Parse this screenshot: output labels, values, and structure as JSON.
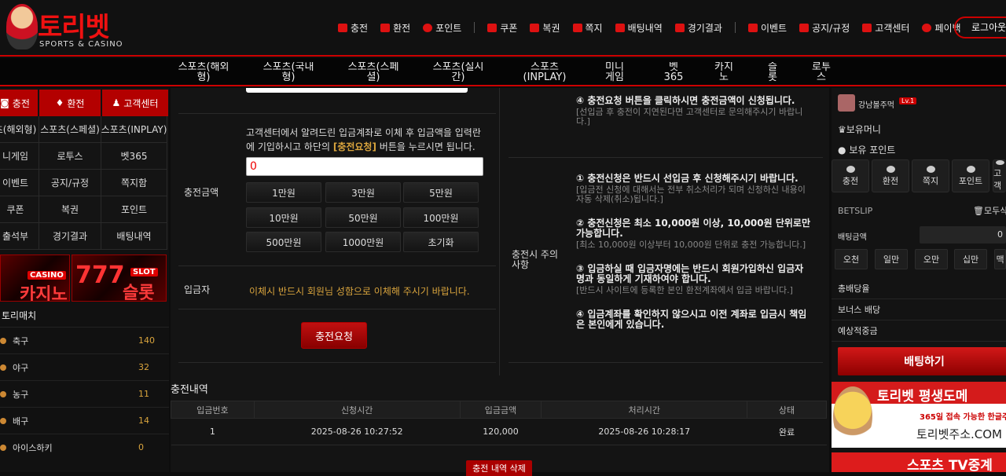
{
  "header": {
    "logo_text": "토리벳",
    "logo_sub": "SPORTS & CASINO",
    "logout": "로그아웃",
    "top_nav": [
      "충전",
      "환전",
      "포인트",
      "쿠폰",
      "복권",
      "쪽지",
      "배팅내역",
      "경기결과",
      "이벤트",
      "공지/규정",
      "고객센터",
      "페이백"
    ]
  },
  "main_nav": [
    "스포츠(해외형)",
    "스포츠(국내형)",
    "스포츠(스페셜)",
    "스포츠(실시간)",
    "스포츠(INPLAY)",
    "미니게임",
    "벳365",
    "카지노",
    "슬롯",
    "로투스"
  ],
  "left": {
    "buttons": [
      "충전",
      "환전",
      "고객센터"
    ],
    "grid": [
      "츠(해외형)",
      "스포츠(스페셜)",
      "스포츠(INPLAY)",
      "니게임",
      "로투스",
      "벳365",
      "이벤트",
      "공지/규정",
      "쪽지함",
      "쿠폰",
      "복권",
      "포인트",
      "출석부",
      "경기결과",
      "배팅내역"
    ],
    "banners": [
      {
        "tag": "CASINO",
        "title": "카지노"
      },
      {
        "tag": "SLOT",
        "title": "슬롯"
      }
    ],
    "sports_header": "토리매치",
    "sports": [
      {
        "name": "축구",
        "count": "140"
      },
      {
        "name": "야구",
        "count": "32"
      },
      {
        "name": "농구",
        "count": "11"
      },
      {
        "name": "배구",
        "count": "14"
      },
      {
        "name": "아이스하키",
        "count": "0"
      }
    ]
  },
  "charge": {
    "amount_label": "충전금액",
    "instruction": "고객센터에서 알려드린 입금계좌로 이체 후 입금액을 입력란에 기입하시고 하단의",
    "instruction_em": "[충전요청]",
    "instruction_end": "버튼을 누르시면 됩니다.",
    "amount_value": "0",
    "amount_buttons": [
      "1만원",
      "3만원",
      "5만원",
      "10만원",
      "50만원",
      "100만원",
      "500만원",
      "1000만원",
      "초기화"
    ],
    "depositor_label": "입금자",
    "depositor_text": "이체시 반드시 회원님 성함으로 이체해 주시기 바랍니다.",
    "submit": "충전요청",
    "notes_label": "충전시 주의사항",
    "notes": [
      {
        "h": "④ 충전요청 버튼을 클릭하시면 충전금액이 신청됩니다.",
        "p": "[선입금 후 충전이 지연된다면 고객센터로 문의해주시기 바랍니다.]"
      },
      {
        "h": "① 충전신청은 반드시 선입금 후 신청해주시기 바랍니다.",
        "p": "[입금전 신청에 대해서는 전부 취소처리가 되며 신청하신 내용이 자동 삭제(취소)됩니다.]"
      },
      {
        "h": "② 충전신청은 최소 10,000원 이상, 10,000원 단위로만 가능합니다.",
        "p": "[최소 10,000원 이상부터 10,000원 단위로 충전 가능합니다.]"
      },
      {
        "h": "③ 입금하실 때 입금자명에는 반드시 회원가입하신 입금자명과 동일하게 기재하여야 합니다.",
        "p": "[반드시 사이트에 등록한 본인 환전계좌에서 입금 바랍니다.]"
      },
      {
        "h": "④ 입금계좌를 확인하지 않으시고 이전 계좌로 입금시 책임은 본인에게 있습니다.",
        "p": ""
      }
    ]
  },
  "history": {
    "title": "충전내역",
    "columns": [
      "입금번호",
      "신청시간",
      "입금금액",
      "처리시간",
      "상태"
    ],
    "rows": [
      [
        "1",
        "2025-08-26 10:27:52",
        "120,000",
        "2025-08-26 10:28:17",
        "완료"
      ]
    ],
    "delete": "충전 내역 삭제"
  },
  "right": {
    "username": "강남볼주먹",
    "level": "Lv.1",
    "money_label": "보유머니",
    "point_label": "보유 포인트",
    "quick": [
      "충전",
      "환전",
      "쪽지",
      "포인트",
      "고객"
    ],
    "betslip": "BETSLIP",
    "clear_all": "모두삭",
    "bet_amount_label": "배팅금액",
    "bet_amount_value": "0",
    "bet_buttons": [
      "오천",
      "일만",
      "오만",
      "십만",
      "백만",
      "맥"
    ],
    "rows": [
      "총배당율",
      "보너스 배당",
      "예상적중금"
    ],
    "bet_button": "배팅하기",
    "ad1_title": "토리벳 평생도메",
    "ad1_sub": "365일 접속 가능한 한글주",
    "ad1_domain": "토리벳주소.COM",
    "ad2_title": "스포츠 TV중계"
  },
  "colors": {
    "accent": "#c00000",
    "gold": "#d9a43d"
  }
}
